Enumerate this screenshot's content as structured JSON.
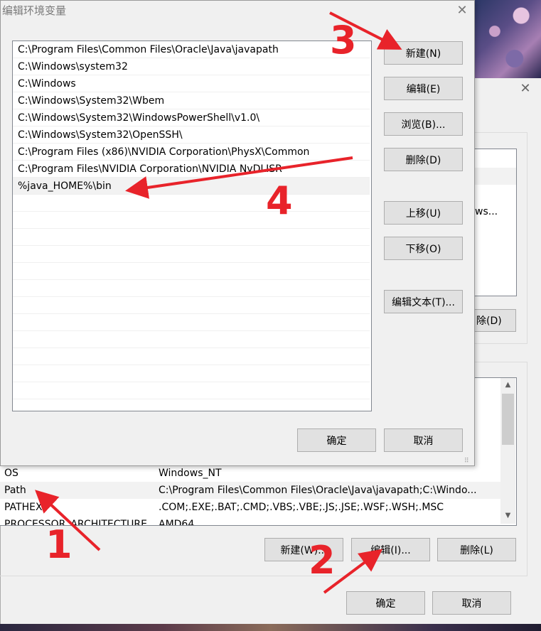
{
  "background_window": {
    "partial_text_right_1": "ws...",
    "partial_button_right": "除(D)",
    "system_vars": [
      {
        "name": "OS",
        "value": "Windows_NT"
      },
      {
        "name": "Path",
        "value": "C:\\Program Files\\Common Files\\Oracle\\Java\\javapath;C:\\Windo..."
      },
      {
        "name": "PATHEXT",
        "value": ".COM;.EXE;.BAT;.CMD;.VBS;.VBE;.JS;.JSE;.WSF;.WSH;.MSC"
      },
      {
        "name": "PROCESSOR_ARCHITECTURE",
        "value": "AMD64"
      }
    ],
    "buttons": {
      "new": "新建(W)...",
      "edit": "编辑(I)...",
      "delete": "删除(L)",
      "ok": "确定",
      "cancel": "取消"
    },
    "close_glyph": "✕"
  },
  "dialog": {
    "title": "编辑环境变量",
    "close_glyph": "✕",
    "paths": [
      "C:\\Program Files\\Common Files\\Oracle\\Java\\javapath",
      "C:\\Windows\\system32",
      "C:\\Windows",
      "C:\\Windows\\System32\\Wbem",
      "C:\\Windows\\System32\\WindowsPowerShell\\v1.0\\",
      "C:\\Windows\\System32\\OpenSSH\\",
      "C:\\Program Files (x86)\\NVIDIA Corporation\\PhysX\\Common",
      "C:\\Program Files\\NVIDIA Corporation\\NVIDIA NvDLISR",
      "%java_HOME%\\bin"
    ],
    "selected_index": 8,
    "buttons": {
      "new": "新建(N)",
      "edit": "编辑(E)",
      "browse": "浏览(B)...",
      "delete": "删除(D)",
      "move_up": "上移(U)",
      "move_down": "下移(O)",
      "edit_text": "编辑文本(T)...",
      "ok": "确定",
      "cancel": "取消"
    }
  },
  "annotations": {
    "step1": "1",
    "step2": "2",
    "step3": "3",
    "step4": "4",
    "color": "#e8232a"
  }
}
